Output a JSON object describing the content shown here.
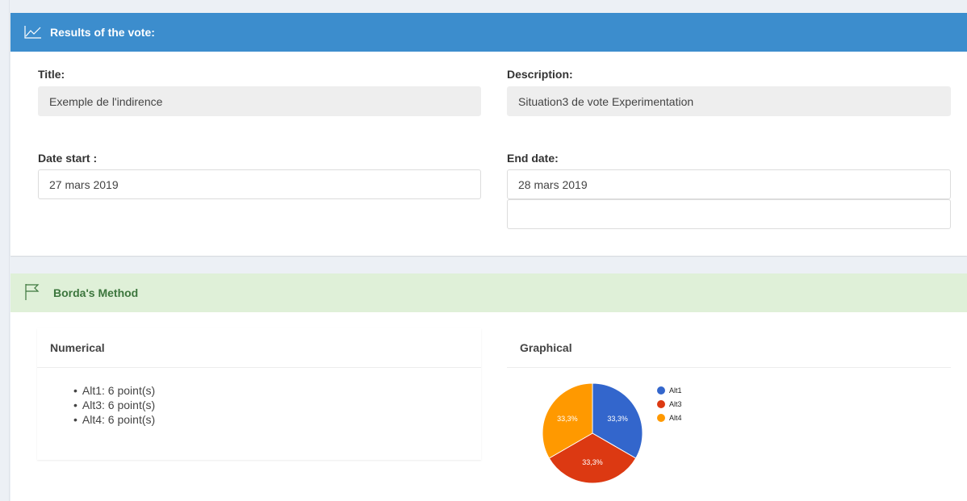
{
  "results": {
    "header_title": "Results of the vote:",
    "title_label": "Title:",
    "title_value": "Exemple de l'indirence",
    "description_label": "Description:",
    "description_value": "Situation3 de vote Experimentation",
    "date_start_label": "Date start :",
    "date_start_value": "27 mars 2019",
    "end_date_label": "End date:",
    "end_date_value": "28 mars 2019",
    "extra_field_value": ""
  },
  "borda": {
    "header_title": "Borda's Method",
    "numerical_title": "Numerical",
    "graphical_title": "Graphical",
    "items": [
      "Alt1: 6 point(s)",
      "Alt3: 6 point(s)",
      "Alt4: 6 point(s)"
    ]
  },
  "colors": {
    "header_blue": "#3c8dcd",
    "header_green_bg": "#dff0d8",
    "header_green_text": "#3c763d",
    "alt1": "#3366cc",
    "alt3": "#dc3912",
    "alt4": "#ff9900"
  },
  "icons": {
    "results_icon": "line-chart-icon",
    "borda_icon": "flag-icon"
  },
  "chart_data": {
    "type": "pie",
    "categories": [
      "Alt1",
      "Alt3",
      "Alt4"
    ],
    "values": [
      6,
      6,
      6
    ],
    "slice_labels": [
      "33,3%",
      "33,3%",
      "33,3%"
    ],
    "legend": "top-right"
  }
}
